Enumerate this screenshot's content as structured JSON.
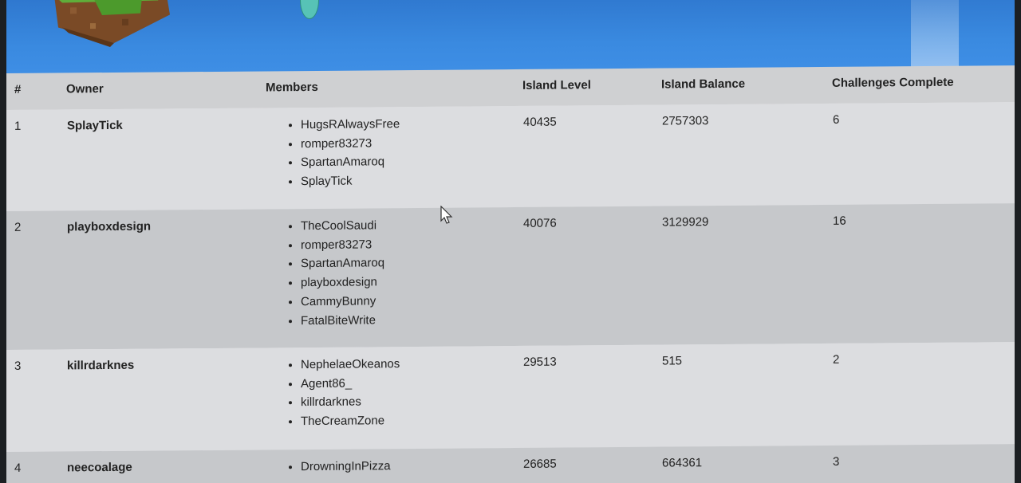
{
  "table": {
    "headers": {
      "rank": "#",
      "owner": "Owner",
      "members": "Members",
      "island_level": "Island Level",
      "island_balance": "Island Balance",
      "challenges_complete": "Challenges Complete"
    },
    "rows": [
      {
        "rank": "1",
        "owner": "SplayTick",
        "members": [
          "HugsRAlwaysFree",
          "romper83273",
          "SpartanAmaroq",
          "SplayTick"
        ],
        "island_level": "40435",
        "island_balance": "2757303",
        "challenges_complete": "6"
      },
      {
        "rank": "2",
        "owner": "playboxdesign",
        "members": [
          "TheCoolSaudi",
          "romper83273",
          "SpartanAmaroq",
          "playboxdesign",
          "CammyBunny",
          "FatalBiteWrite"
        ],
        "island_level": "40076",
        "island_balance": "3129929",
        "challenges_complete": "16"
      },
      {
        "rank": "3",
        "owner": "killrdarknes",
        "members": [
          "NephelaeOkeanos",
          "Agent86_",
          "killrdarknes",
          "TheCreamZone"
        ],
        "island_level": "29513",
        "island_balance": "515",
        "challenges_complete": "2"
      },
      {
        "rank": "4",
        "owner": "neecoalage",
        "members": [
          "DrowningInPizza"
        ],
        "island_level": "26685",
        "island_balance": "664361",
        "challenges_complete": "3"
      }
    ]
  },
  "colors": {
    "banner": "#3a8ae0",
    "header_row": "#cfd0d2",
    "row_light": "#dcdde0",
    "row_dark": "#c6c8cb"
  },
  "icons": {
    "banner_art": "grass-block-island-icon",
    "pointer": "mouse-cursor-icon"
  }
}
